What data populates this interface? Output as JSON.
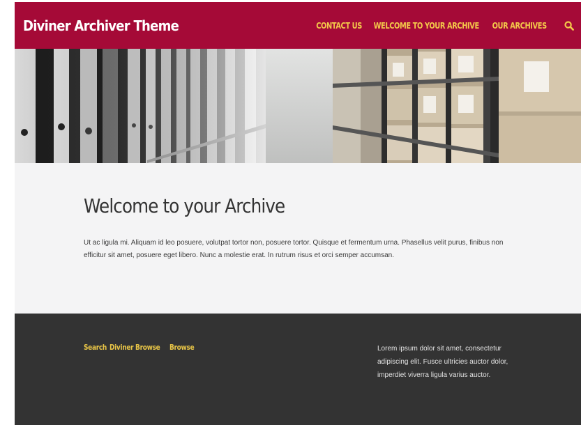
{
  "header": {
    "site_title": "Diviner Archiver Theme",
    "nav": [
      "CONTACT US",
      "WELCOME TO YOUR ARCHIVE",
      "OUR ARCHIVES"
    ],
    "background_color": "#a50a37",
    "link_color": "#f3c84a",
    "search_icon": "search-icon"
  },
  "hero": {
    "description_icon": "archive-shelves-photo"
  },
  "main": {
    "title": "Welcome to your Archive",
    "body": "Ut ac ligula mi. Aliquam id leo posuere, volutpat tortor non, posuere tortor. Quisque et fermentum urna. Phasellus velit purus, finibus non efficitur sit amet, posuere eget libero. Nunc a molestie erat. In rutrum risus et orci semper ac­cumsan."
  },
  "footer": {
    "links": [
      "Search",
      "Diviner Browse",
      "Browse"
    ],
    "text": "Lorem ipsum dolor sit amet, con­sectetur adipiscing elit. Fusce ul­tricies auctor dolor, imperdiet viverra ligula varius auctor.",
    "background_color": "#333333",
    "link_color": "#e8c547"
  }
}
